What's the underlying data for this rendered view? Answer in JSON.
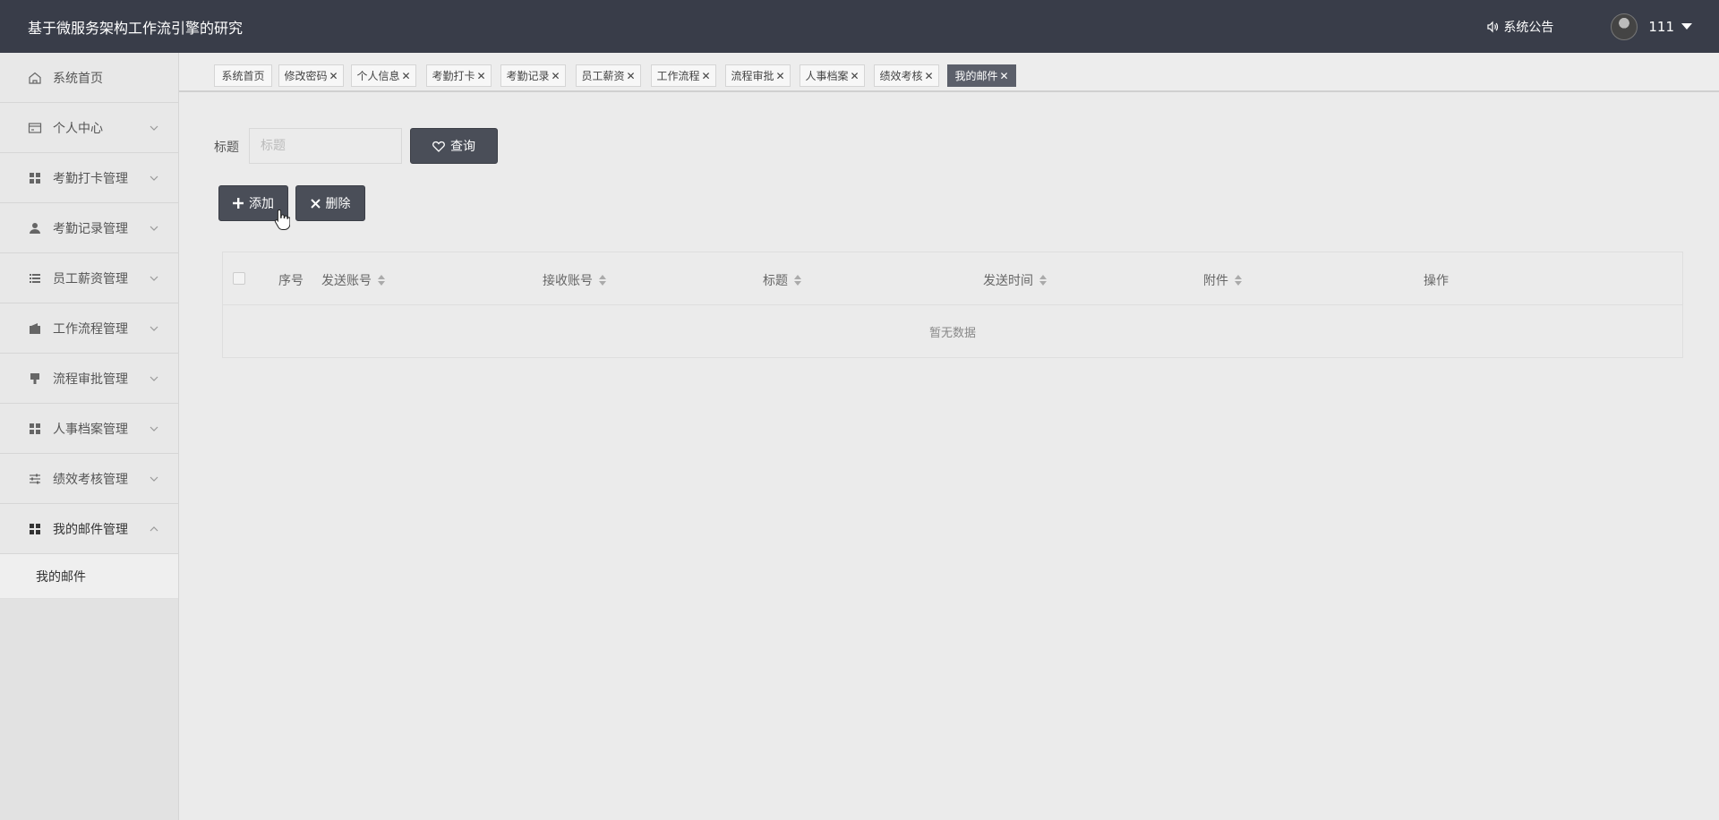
{
  "app": {
    "title": "基于微服务架构工作流引擎的研究"
  },
  "header": {
    "notice_label": "系统公告",
    "username": "111"
  },
  "sidebar": {
    "items": [
      {
        "label": "系统首页",
        "icon": "home-icon"
      },
      {
        "label": "个人中心",
        "icon": "card-icon"
      },
      {
        "label": "考勤打卡管理",
        "icon": "grid-icon"
      },
      {
        "label": "考勤记录管理",
        "icon": "user-icon"
      },
      {
        "label": "员工薪资管理",
        "icon": "list-icon"
      },
      {
        "label": "工作流程管理",
        "icon": "wallet-icon"
      },
      {
        "label": "流程审批管理",
        "icon": "stamp-icon"
      },
      {
        "label": "人事档案管理",
        "icon": "grid-icon"
      },
      {
        "label": "绩效考核管理",
        "icon": "sliders-icon"
      },
      {
        "label": "我的邮件管理",
        "icon": "grid-icon"
      }
    ],
    "submenu": [
      {
        "label": "我的邮件"
      }
    ]
  },
  "tabs": [
    {
      "label": "系统首页",
      "closable": false
    },
    {
      "label": "修改密码",
      "closable": true
    },
    {
      "label": "个人信息",
      "closable": true
    },
    {
      "label": "考勤打卡",
      "closable": true
    },
    {
      "label": "考勤记录",
      "closable": true
    },
    {
      "label": "员工薪资",
      "closable": true
    },
    {
      "label": "工作流程",
      "closable": true
    },
    {
      "label": "流程审批",
      "closable": true
    },
    {
      "label": "人事档案",
      "closable": true
    },
    {
      "label": "绩效考核",
      "closable": true
    },
    {
      "label": "我的邮件",
      "closable": true,
      "active": true
    }
  ],
  "search": {
    "label": "标题",
    "placeholder": "标题",
    "query_button": "查询"
  },
  "actions": {
    "add_button": "添加",
    "delete_button": "删除"
  },
  "table": {
    "columns": [
      "序号",
      "发送账号",
      "接收账号",
      "标题",
      "发送时间",
      "附件",
      "操作"
    ],
    "empty_text": "暂无数据"
  },
  "colors": {
    "header_bg": "#393d49",
    "button_bg": "#4a4e58",
    "active_tab": "#5b5f6a"
  }
}
